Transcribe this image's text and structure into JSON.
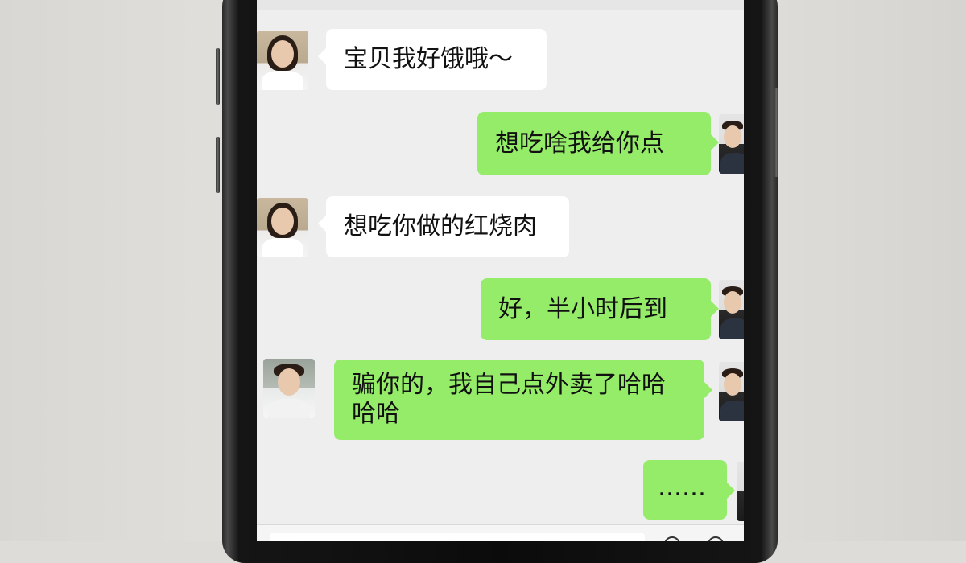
{
  "chat": {
    "messages": [
      {
        "side": "left",
        "avatar": "female-avatar",
        "text": "宝贝我好饿哦～"
      },
      {
        "side": "right",
        "avatar": "my-avatar",
        "text": "想吃啥我给你点"
      },
      {
        "side": "left",
        "avatar": "female-avatar",
        "text": "想吃你做的红烧肉"
      },
      {
        "side": "right",
        "avatar": "my-avatar",
        "text": "好，半小时后到"
      },
      {
        "side": "right",
        "avatar": "my-avatar",
        "text": "骗你的，我自己点外卖了哈哈哈哈"
      },
      {
        "side": "right",
        "avatar": "my-avatar",
        "text": "……"
      }
    ]
  },
  "colors": {
    "chat_background": "#eeeeee",
    "sent_bubble": "#95ec69",
    "received_bubble": "#ffffff"
  },
  "icons": {
    "voice": "voice-icon",
    "emoji": "emoji-icon",
    "plus": "plus-icon"
  }
}
